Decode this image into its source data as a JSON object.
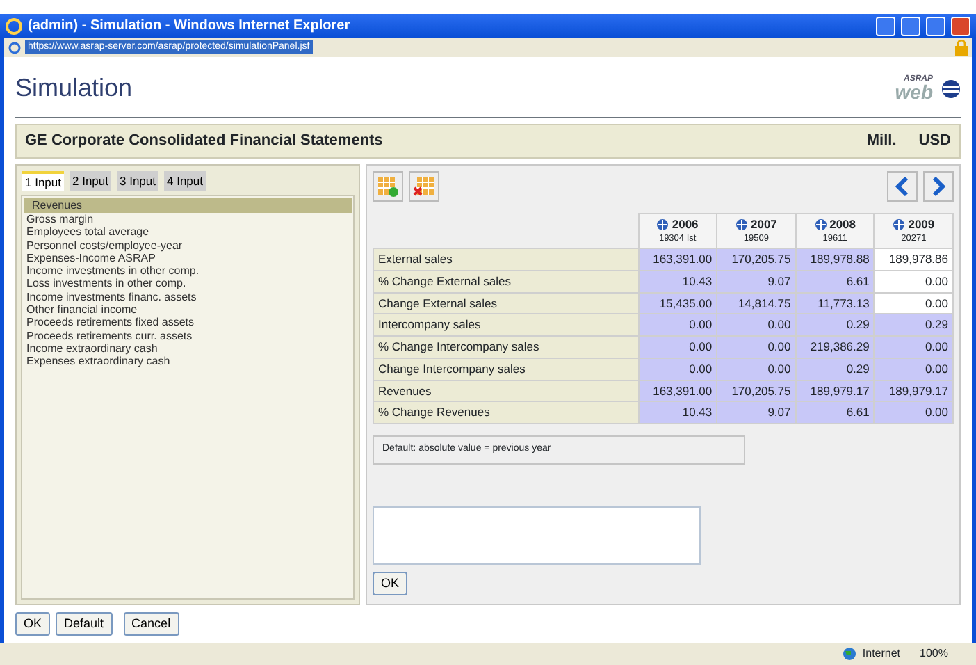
{
  "window": {
    "title": "(admin) - Simulation - Windows Internet Explorer",
    "address": "https://www.asrap-server.com/asrap/protected/simulationPanel.jsf"
  },
  "page": {
    "title": "Simulation",
    "logo_top": "ASRAP",
    "logo_bottom": "web"
  },
  "band": {
    "title": "GE Corporate Consolidated Financial Statements",
    "unit": "Mill.",
    "currency": "USD"
  },
  "tabs": [
    {
      "label": "1 Input",
      "selected": true
    },
    {
      "label": "2 Input",
      "selected": false
    },
    {
      "label": "3 Input",
      "selected": false
    },
    {
      "label": "4 Input",
      "selected": false
    }
  ],
  "items": [
    {
      "label": "Revenues",
      "selected": true
    },
    {
      "label": "Gross margin",
      "selected": false
    },
    {
      "label": "Employees total average",
      "selected": false
    },
    {
      "label": "Personnel costs/employee-year",
      "selected": false
    },
    {
      "label": "Expenses-Income ASRAP",
      "selected": false
    },
    {
      "label": "Income investments in other comp.",
      "selected": false
    },
    {
      "label": "Loss investments in other comp.",
      "selected": false
    },
    {
      "label": "Income investments financ. assets",
      "selected": false
    },
    {
      "label": "Other financial income",
      "selected": false
    },
    {
      "label": "Proceeds retirements fixed assets",
      "selected": false
    },
    {
      "label": "Proceeds retirements curr. assets",
      "selected": false
    },
    {
      "label": "Income extraordinary cash",
      "selected": false
    },
    {
      "label": "Expenses extraordinary cash",
      "selected": false
    }
  ],
  "table": {
    "columns": [
      {
        "year": "2006",
        "sub": "19304 Ist"
      },
      {
        "year": "2007",
        "sub": "19509"
      },
      {
        "year": "2008",
        "sub": "19611"
      },
      {
        "year": "2009",
        "sub": "20271"
      }
    ],
    "rows": [
      {
        "label": "External sales",
        "cells": [
          {
            "value": "163,391.00",
            "editable": false
          },
          {
            "value": "170,205.75",
            "editable": false
          },
          {
            "value": "189,978.88",
            "editable": false
          },
          {
            "value": "189,978.86",
            "editable": true
          }
        ]
      },
      {
        "label": "% Change External sales",
        "cells": [
          {
            "value": "10.43",
            "editable": false
          },
          {
            "value": "9.07",
            "editable": false
          },
          {
            "value": "6.61",
            "editable": false
          },
          {
            "value": "0.00",
            "editable": true
          }
        ]
      },
      {
        "label": "Change External sales",
        "cells": [
          {
            "value": "15,435.00",
            "editable": false
          },
          {
            "value": "14,814.75",
            "editable": false
          },
          {
            "value": "11,773.13",
            "editable": false
          },
          {
            "value": "0.00",
            "editable": true
          }
        ]
      },
      {
        "label": "Intercompany sales",
        "cells": [
          {
            "value": "0.00",
            "editable": false
          },
          {
            "value": "0.00",
            "editable": false
          },
          {
            "value": "0.29",
            "editable": false
          },
          {
            "value": "0.29",
            "editable": false
          }
        ]
      },
      {
        "label": "% Change Intercompany sales",
        "cells": [
          {
            "value": "0.00",
            "editable": false
          },
          {
            "value": "0.00",
            "editable": false
          },
          {
            "value": "219,386.29",
            "editable": false
          },
          {
            "value": "0.00",
            "editable": false
          }
        ]
      },
      {
        "label": "Change Intercompany sales",
        "cells": [
          {
            "value": "0.00",
            "editable": false
          },
          {
            "value": "0.00",
            "editable": false
          },
          {
            "value": "0.29",
            "editable": false
          },
          {
            "value": "0.00",
            "editable": false
          }
        ]
      },
      {
        "label": "Revenues",
        "cells": [
          {
            "value": "163,391.00",
            "editable": false
          },
          {
            "value": "170,205.75",
            "editable": false
          },
          {
            "value": "189,979.17",
            "editable": false
          },
          {
            "value": "189,979.17",
            "editable": false
          }
        ]
      },
      {
        "label": "% Change Revenues",
        "cells": [
          {
            "value": "10.43",
            "editable": false
          },
          {
            "value": "9.07",
            "editable": false
          },
          {
            "value": "6.61",
            "editable": false
          },
          {
            "value": "0.00",
            "editable": false
          }
        ]
      }
    ]
  },
  "note": "Default: absolute value = previous year",
  "comment_button": "OK",
  "buttons": [
    "OK",
    "Default",
    "Cancel"
  ],
  "status_bar": {
    "zone": "Internet",
    "zoom": "100%"
  }
}
